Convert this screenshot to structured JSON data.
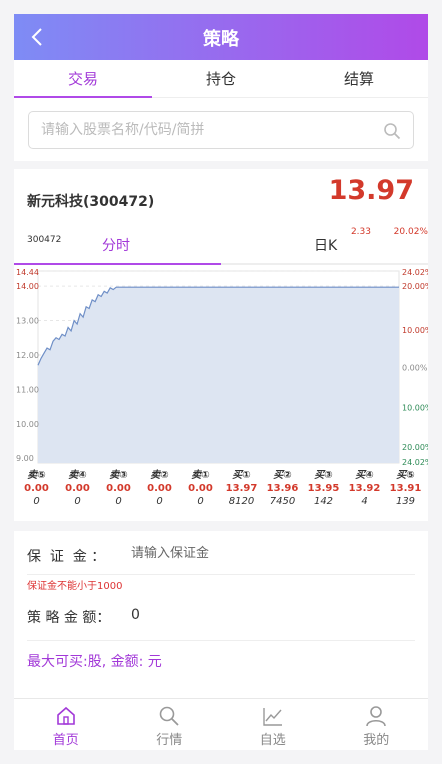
{
  "header": {
    "title": "策略",
    "back_icon": "chevron-left-icon"
  },
  "tabs": [
    {
      "label": "交易"
    },
    {
      "label": "持仓"
    },
    {
      "label": "结算"
    }
  ],
  "search": {
    "placeholder": "请输入股票名称/代码/简拼",
    "icon": "search-icon"
  },
  "stock": {
    "name": "新元科技(300472)",
    "price": "13.97",
    "code": "300472",
    "change": "2.33",
    "change_pct": "20.02%"
  },
  "chart_tabs": {
    "intraday": "分时",
    "daily": "日K"
  },
  "chart_data": {
    "type": "area",
    "left_ticks": [
      "14.44",
      "14.00",
      "13.00",
      "12.00",
      "11.00",
      "10.00",
      "9.00"
    ],
    "right_ticks": [
      "24.02%",
      "20.00%",
      "10.00%",
      "0.00%",
      "10.00%",
      "20.00%",
      "24.02%"
    ],
    "ylim": [
      8.86,
      14.44
    ],
    "x": [
      0,
      2,
      4,
      6,
      8,
      10,
      12,
      14,
      16,
      18,
      20,
      22,
      24,
      26,
      28,
      30,
      32,
      34,
      36,
      38,
      40,
      42,
      44,
      46,
      48,
      50,
      52,
      54,
      56,
      58,
      60,
      240
    ],
    "values": [
      11.7,
      11.9,
      12.05,
      12.2,
      12.15,
      12.4,
      12.5,
      12.45,
      12.6,
      12.55,
      12.8,
      12.7,
      13.0,
      12.9,
      13.2,
      13.1,
      13.4,
      13.35,
      13.6,
      13.55,
      13.75,
      13.7,
      13.85,
      13.8,
      13.95,
      13.9,
      13.97,
      13.97,
      13.97,
      13.97,
      13.97,
      13.97
    ],
    "fill_color": "#dde5f2",
    "line_color": "#6f8fc7"
  },
  "quotes": [
    {
      "label": "卖⑤",
      "price": "0.00",
      "volume": "0"
    },
    {
      "label": "卖④",
      "price": "0.00",
      "volume": "0"
    },
    {
      "label": "卖③",
      "price": "0.00",
      "volume": "0"
    },
    {
      "label": "卖②",
      "price": "0.00",
      "volume": "0"
    },
    {
      "label": "卖①",
      "price": "0.00",
      "volume": "0"
    },
    {
      "label": "买①",
      "price": "13.97",
      "volume": "8120"
    },
    {
      "label": "买②",
      "price": "13.96",
      "volume": "7450"
    },
    {
      "label": "买③",
      "price": "13.95",
      "volume": "142"
    },
    {
      "label": "买④",
      "price": "13.92",
      "volume": "4"
    },
    {
      "label": "买⑤",
      "price": "13.91",
      "volume": "139"
    }
  ],
  "form": {
    "deposit_label": "保  证  金 ：",
    "deposit_placeholder": "请输入保证金",
    "deposit_warning": "保证金不能小于1000",
    "amount_label": "策 略 金 额：",
    "amount_value": "0",
    "max_buy": "最大可买:股, 金额: 元"
  },
  "nav": [
    {
      "label": "首页",
      "icon": "home-icon"
    },
    {
      "label": "行情",
      "icon": "search-icon"
    },
    {
      "label": "自选",
      "icon": "chart-line-icon"
    },
    {
      "label": "我的",
      "icon": "user-icon"
    }
  ],
  "colors": {
    "accent": "#a239d8",
    "header_start": "#7e8cf5",
    "header_end": "#b04ae8",
    "price_red": "#d3392b"
  }
}
